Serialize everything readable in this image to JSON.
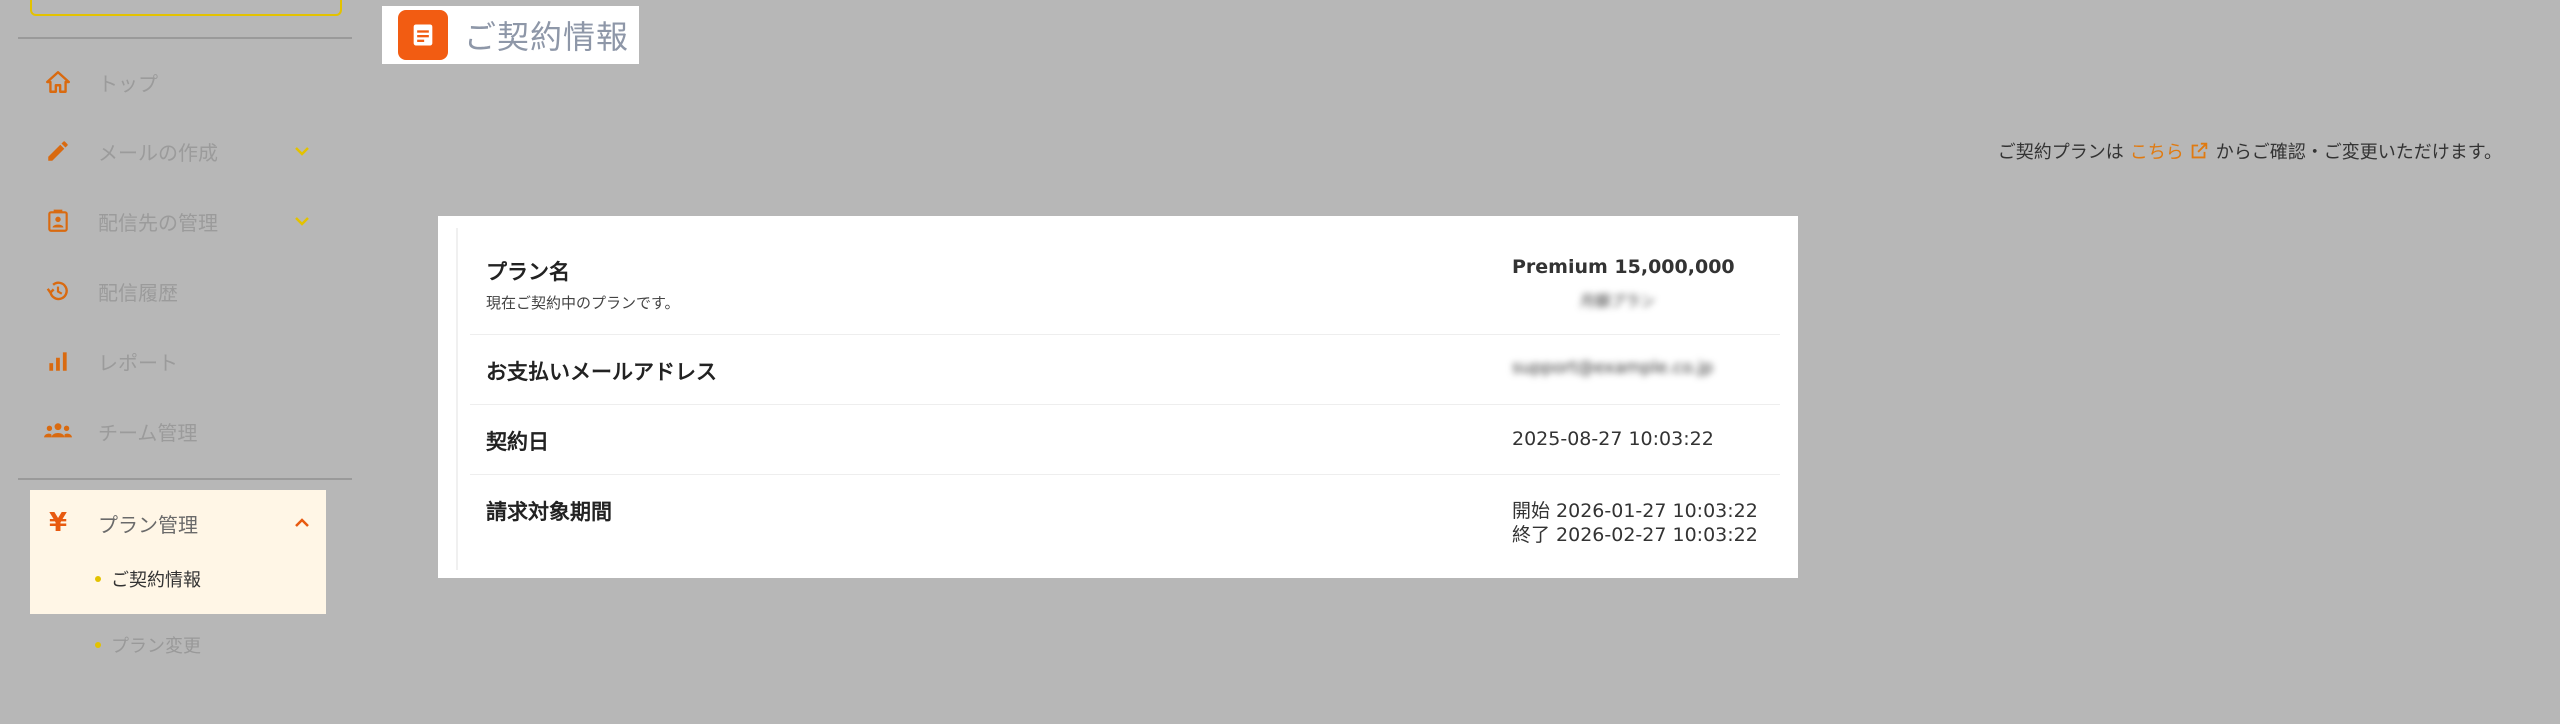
{
  "sidebar": {
    "items": [
      {
        "label": "トップ",
        "icon": "home-icon"
      },
      {
        "label": "メールの作成",
        "icon": "pencil-icon"
      },
      {
        "label": "配信先の管理",
        "icon": "contact-book-icon"
      },
      {
        "label": "配信履歴",
        "icon": "history-icon"
      },
      {
        "label": "レポート",
        "icon": "bar-chart-icon"
      },
      {
        "label": "チーム管理",
        "icon": "team-icon"
      }
    ],
    "plan_group": {
      "label": "プラン管理",
      "icon_glyph": "¥",
      "sub_items": [
        {
          "label": "ご契約情報"
        },
        {
          "label": "プラン変更"
        }
      ]
    }
  },
  "header": {
    "title": "ご契約情報"
  },
  "notice": {
    "prefix": "ご契約プランは",
    "link": "こちら",
    "suffix": "からご確認・ご変更いただけます。"
  },
  "contract": {
    "rows": [
      {
        "key": "プラン名",
        "sub": "現在ご契約中のプランです。",
        "value": "Premium 15,000,000",
        "value_sub": "月額プラン"
      },
      {
        "key": "お支払いメールアドレス",
        "value": "support@example.co.jp"
      },
      {
        "key": "契約日",
        "value": "2025-08-27 10:03:22"
      },
      {
        "key": "請求対象期間",
        "value_start": "開始 2026-01-27 10:03:22",
        "value_end": "終了 2026-02-27 10:03:22"
      }
    ]
  },
  "colors": {
    "accent": "#f25c12",
    "link": "#e07a10",
    "plan_value": "#1a64b4",
    "background": "#b7b7b7"
  }
}
